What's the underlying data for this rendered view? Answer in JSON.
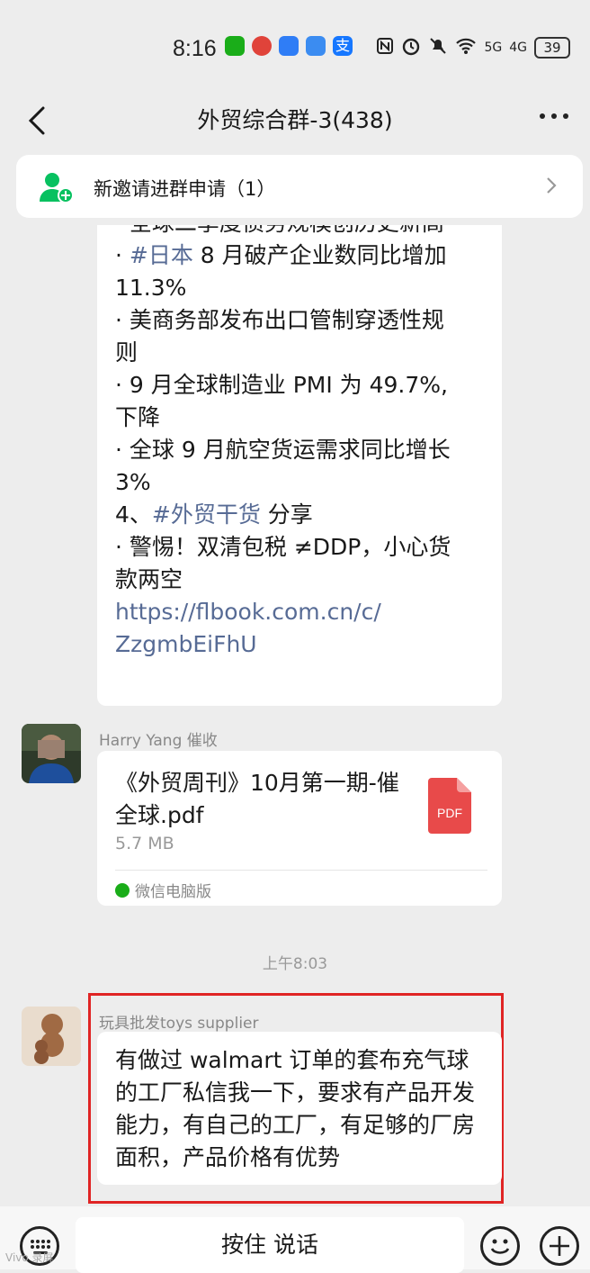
{
  "status_bar": {
    "time": "8:16",
    "network_5g": "5G",
    "network_4g": "4G",
    "battery": "39"
  },
  "nav": {
    "title": "外贸综合群-3(438)"
  },
  "banner": {
    "text": "新邀请进群申请（1）"
  },
  "article": {
    "lines": [
      "· 全球二季度债务规模创历史新高",
      "· #日本 8 月破产企业数同比增加",
      "11.3%",
      "· 美商务部发布出口管制穿透性规",
      "则",
      "· 9 月全球制造业 PMI 为 49.7%,",
      "下降",
      "· 全球 9 月航空货运需求同比增长",
      "3%",
      "4、#外贸干货 分享",
      "· 警惕！双清包税 ≠DDP，小心货",
      "款两空",
      "https://flbook.com.cn/c/",
      "ZzgmbEiFhU"
    ],
    "hashtag_japan": "#日本",
    "hashtag_tips": "#外贸干货",
    "link_line1": "https://flbook.com.cn/c/",
    "link_line2": "ZzgmbEiFhU"
  },
  "file_message": {
    "sender": "Harry Yang 催收",
    "file_name": "《外贸周刊》10月第一期-催全球.pdf",
    "file_size": "5.7 MB",
    "file_badge": "PDF",
    "source": "微信电脑版"
  },
  "timestamp": "上午8:03",
  "text_message": {
    "sender": "玩具批发toys supplier",
    "text": "有做过 walmart 订单的套布充气球的工厂私信我一下，要求有产品开发能力，有自己的工厂，有足够的厂房面积，产品价格有优势"
  },
  "input_bar": {
    "talk_label": "按住 说话"
  },
  "watermark": "Vivo 录屏"
}
